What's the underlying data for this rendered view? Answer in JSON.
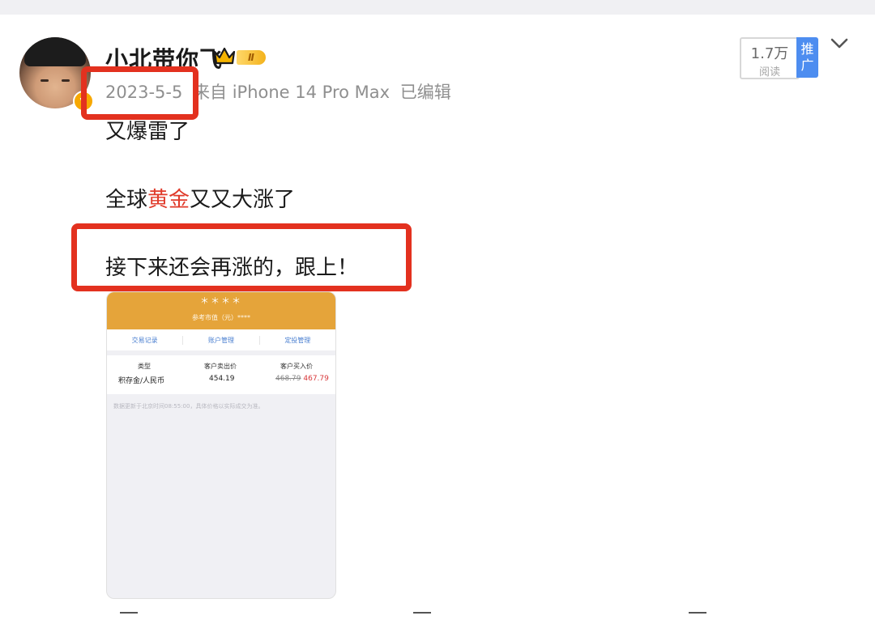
{
  "post": {
    "author": {
      "name": "小北带你飞",
      "level_badge": "Ⅱ",
      "verified_badge": "V"
    },
    "meta": {
      "date": "2023-5-5",
      "source": "来自 iPhone 14 Pro Max",
      "edited": "已编辑"
    },
    "stats": {
      "reads_count": "1.7万",
      "reads_label": "阅读",
      "promote_label_1": "推",
      "promote_label_2": "广"
    },
    "content": {
      "line1": "又爆雷了",
      "line2_pre": "全球",
      "line2_highlight": "黄金",
      "line2_post": "又又大涨了",
      "line3": "接下来还会再涨的，跟上！"
    },
    "highlight_color": "#e03b2b",
    "annotation_color": "#e3311f"
  },
  "embedded_image": {
    "stars": "＊＊＊＊",
    "ref_value": "参考市值（元）****",
    "tabs": [
      "交易记录",
      "账户管理",
      "定投管理"
    ],
    "table": {
      "headers": [
        "类型",
        "客户卖出价",
        "客户买入价"
      ],
      "type": "积存金/人民币",
      "sell_price": "454.19",
      "buy_price_old": "468.79",
      "buy_price_new": "467.79"
    },
    "note": "数据更新于北京时间08:55:00，具体价格以实际成交为准。",
    "header_color": "#e5a43a"
  }
}
